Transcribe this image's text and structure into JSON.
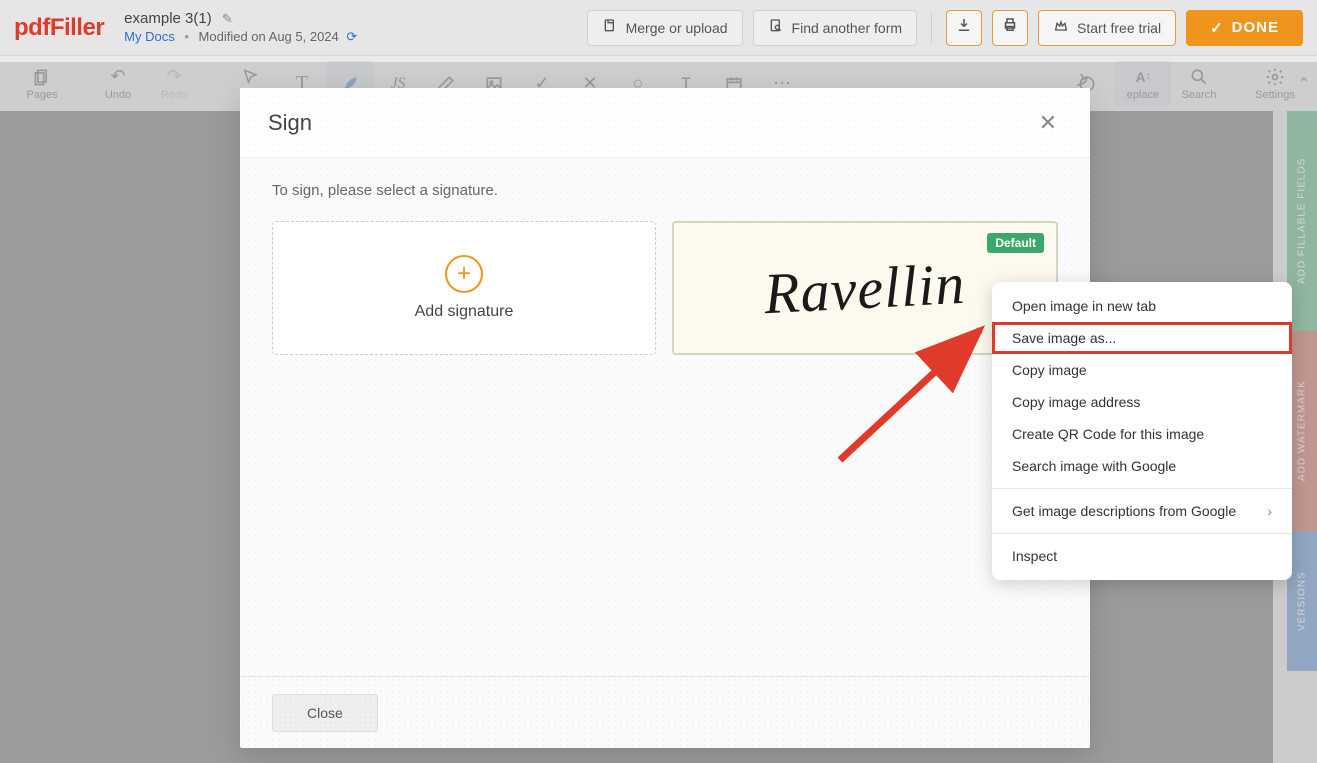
{
  "logo_text": "pdfFiller",
  "doc_title": "example 3(1)",
  "breadcrumb_link": "My Docs",
  "modified_text": "Modified on Aug 5, 2024",
  "header_buttons": {
    "merge": "Merge or upload",
    "find": "Find another form",
    "trial": "Start free trial",
    "done": "DONE"
  },
  "toolbar": {
    "pages": "Pages",
    "undo": "Undo",
    "redo": "Redo",
    "select": "Se",
    "replace": "eplace",
    "search": "Search",
    "settings": "Settings"
  },
  "modal": {
    "title": "Sign",
    "instruction": "To sign, please select a signature.",
    "add_signature": "Add signature",
    "default_badge": "Default",
    "signature_name": "Ravellin",
    "close": "Close"
  },
  "context_menu": {
    "open_new_tab": "Open image in new tab",
    "save_as": "Save image as...",
    "copy_image": "Copy image",
    "copy_address": "Copy image address",
    "create_qr": "Create QR Code for this image",
    "search_google": "Search image with Google",
    "get_descriptions": "Get image descriptions from Google",
    "inspect": "Inspect"
  },
  "side_tabs": {
    "fillable": "ADD FILLABLE FIELDS",
    "watermark": "ADD WATERMARK",
    "versions": "VERSIONS"
  }
}
